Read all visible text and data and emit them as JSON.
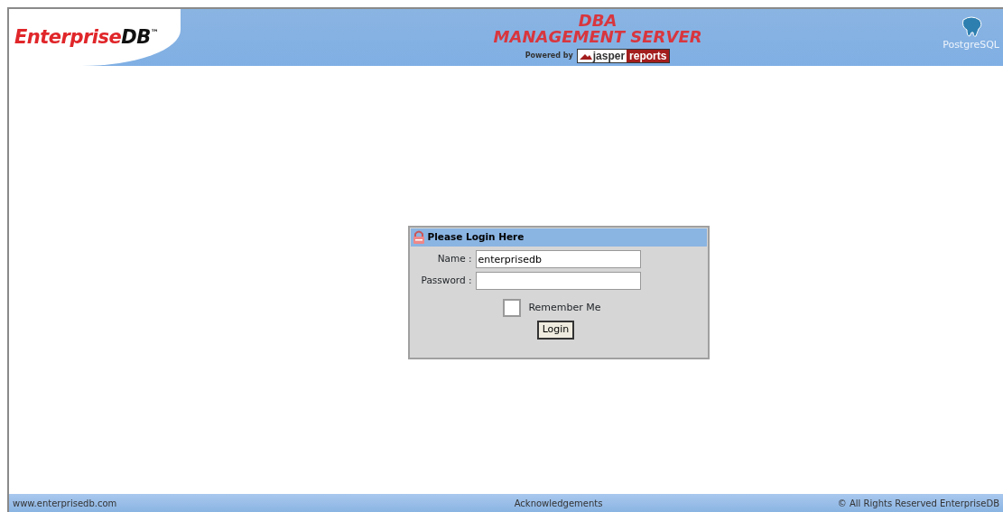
{
  "header": {
    "logo": {
      "brand": "Enterprise",
      "suffix": "DB",
      "mark": "™"
    },
    "title": [
      "DBA",
      "MANAGEMENT SERVER"
    ],
    "powered_by": "Powered by",
    "reports_logo": {
      "first": "jasper",
      "second": "reports"
    },
    "partner": "PostgreSQL"
  },
  "login": {
    "title": "Please Login Here",
    "fields": [
      {
        "label": "Name :",
        "value": "enterprisedb"
      },
      {
        "label": "Password :"
      }
    ],
    "remember": {
      "label": "Remember Me",
      "checked": false
    },
    "button": "Login"
  },
  "footer": [
    "www.enterprisedb.com",
    "Acknowledgements",
    "© All Rights Reserved EnterpriseDB"
  ]
}
